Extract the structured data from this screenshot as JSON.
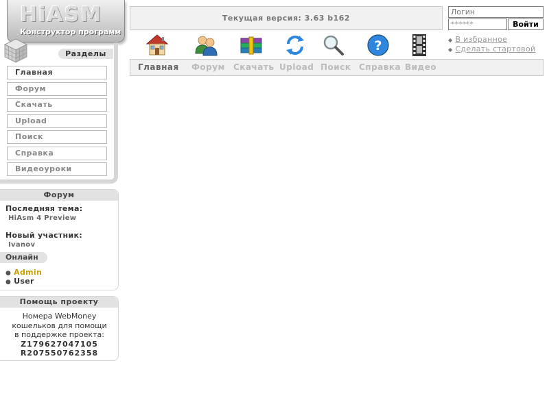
{
  "logo": {
    "title": "HiASM",
    "subtitle": "Конструктор программ"
  },
  "sidebar": {
    "section_title": "Разделы",
    "items": [
      {
        "label": "Главная",
        "active": true
      },
      {
        "label": "Форум"
      },
      {
        "label": "Скачать"
      },
      {
        "label": "Upload"
      },
      {
        "label": "Поиск"
      },
      {
        "label": "Справка"
      },
      {
        "label": "Видеоуроки"
      }
    ]
  },
  "forum_box": {
    "title": "Форум",
    "last_topic_label": "Последняя тема:",
    "last_topic_value": "HiAsm 4 Preview",
    "new_member_label": "Новый участник:",
    "new_member_value": "Ivanov",
    "online_label": "Онлайн",
    "online_users": [
      "Admin",
      "User"
    ]
  },
  "help_box": {
    "title": "Помощь проекту",
    "line1": "Номера WebMoney",
    "line2": "кошельков для помощи",
    "line3": "в поддержке проекта:",
    "wallet1": "Z179627047105",
    "wallet2": "R207550762358"
  },
  "header": {
    "version_text": "Текущая версия: 3.63 b162"
  },
  "login": {
    "username_placeholder": "Логин",
    "password_value": "******",
    "submit_label": "Войти",
    "links": [
      "В избранное",
      "Сделать стартовой"
    ]
  },
  "toolbar": {
    "icons": [
      "home-icon",
      "users-forum-icon",
      "archive-download-icon",
      "refresh-upload-icon",
      "magnifier-search-icon",
      "question-help-icon",
      "film-video-icon"
    ],
    "items": [
      {
        "label": "Главная",
        "active": true
      },
      {
        "label": "Форум"
      },
      {
        "label": "Скачать"
      },
      {
        "label": "Upload"
      },
      {
        "label": "Поиск"
      },
      {
        "label": "Справка"
      },
      {
        "label": "Видео"
      }
    ]
  },
  "colors": {
    "accent_gold": "#c9a000",
    "panel_gray": "#f1f1f1",
    "border_gray": "#c8c8c8"
  }
}
